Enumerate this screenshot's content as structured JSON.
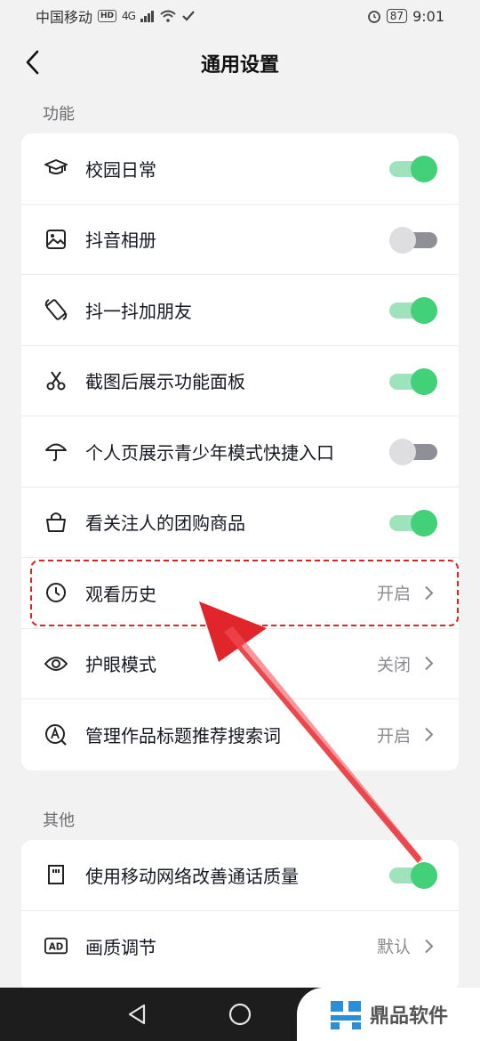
{
  "status_bar": {
    "carrier": "中国移动",
    "hd": "HD",
    "network": "4G",
    "battery": "87",
    "time": "9:01"
  },
  "header": {
    "title": "通用设置"
  },
  "sections": {
    "features": {
      "label": "功能",
      "items": [
        {
          "label": "校园日常",
          "icon": "graduation-cap-icon",
          "toggle": "on"
        },
        {
          "label": "抖音相册",
          "icon": "image-icon",
          "toggle": "off"
        },
        {
          "label": "抖一抖加朋友",
          "icon": "shake-phone-icon",
          "toggle": "on"
        },
        {
          "label": "截图后展示功能面板",
          "icon": "scissors-icon",
          "toggle": "on"
        },
        {
          "label": "个人页展示青少年模式快捷入口",
          "icon": "umbrella-icon",
          "toggle": "off"
        },
        {
          "label": "看关注人的团购商品",
          "icon": "shopping-bag-icon",
          "toggle": "on"
        },
        {
          "label": "观看历史",
          "icon": "clock-icon",
          "value": "开启"
        },
        {
          "label": "护眼模式",
          "icon": "eye-icon",
          "value": "关闭"
        },
        {
          "label": "管理作品标题推荐搜索词",
          "icon": "search-a-icon",
          "value": "开启"
        }
      ]
    },
    "other": {
      "label": "其他",
      "items": [
        {
          "label": "使用移动网络改善通话质量",
          "icon": "sim-card-icon",
          "toggle": "on"
        },
        {
          "label": "画质调节",
          "icon": "ad-badge-icon",
          "icon_text": "AD",
          "value": "默认"
        }
      ]
    }
  },
  "watermark": {
    "text": "鼎品软件"
  },
  "colors": {
    "toggle_on": "#42d178",
    "toggle_off": "#dedee0",
    "annotation": "#dd2222"
  }
}
